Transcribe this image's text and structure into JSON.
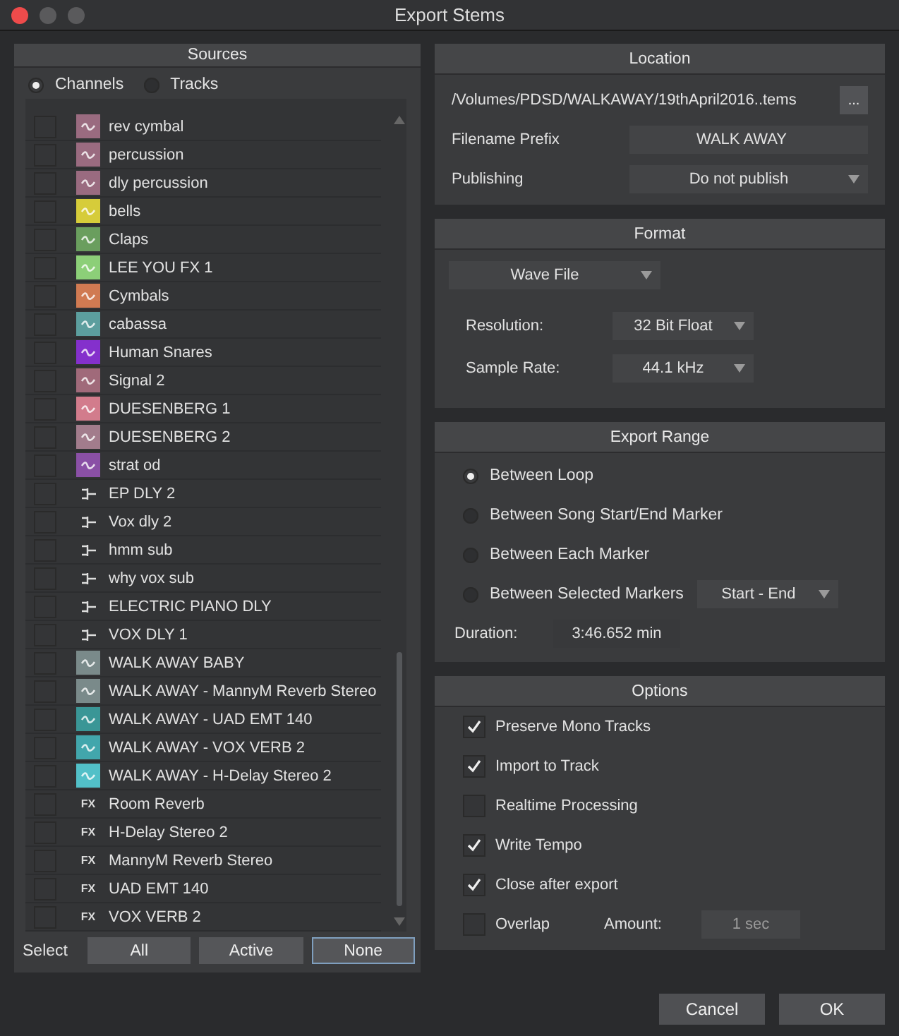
{
  "window": {
    "title": "Export Stems"
  },
  "sources": {
    "title": "Sources",
    "modes": [
      {
        "label": "Channels",
        "selected": true
      },
      {
        "label": "Tracks",
        "selected": false
      }
    ],
    "items": [
      {
        "kind": "audio",
        "name": "rev cymbal",
        "color": "#9a6b80",
        "checked": false
      },
      {
        "kind": "audio",
        "name": "percussion",
        "color": "#9a6b80",
        "checked": false
      },
      {
        "kind": "audio",
        "name": "dly percussion",
        "color": "#9a6b80",
        "checked": false
      },
      {
        "kind": "audio",
        "name": "bells",
        "color": "#d6cc3a",
        "checked": false
      },
      {
        "kind": "audio",
        "name": "Claps",
        "color": "#6a9e5e",
        "checked": false
      },
      {
        "kind": "audio",
        "name": "LEE YOU FX 1",
        "color": "#8ccf78",
        "checked": false
      },
      {
        "kind": "audio",
        "name": "Cymbals",
        "color": "#d07a52",
        "checked": false
      },
      {
        "kind": "audio",
        "name": "cabassa",
        "color": "#5c9e9e",
        "checked": false
      },
      {
        "kind": "audio",
        "name": "Human Snares",
        "color": "#8430cc",
        "checked": false
      },
      {
        "kind": "audio",
        "name": "Signal 2",
        "color": "#a06a7a",
        "checked": false
      },
      {
        "kind": "audio",
        "name": "DUESENBERG 1",
        "color": "#d27c8c",
        "checked": false
      },
      {
        "kind": "audio",
        "name": "DUESENBERG 2",
        "color": "#a27c8c",
        "checked": false
      },
      {
        "kind": "audio",
        "name": "strat od",
        "color": "#8a50a6",
        "checked": false
      },
      {
        "kind": "bus",
        "name": "EP DLY 2",
        "checked": false
      },
      {
        "kind": "bus",
        "name": "Vox dly 2",
        "checked": false
      },
      {
        "kind": "bus",
        "name": "hmm sub",
        "checked": false
      },
      {
        "kind": "bus",
        "name": "why vox sub",
        "checked": false
      },
      {
        "kind": "bus",
        "name": "ELECTRIC PIANO DLY",
        "checked": false
      },
      {
        "kind": "bus",
        "name": "VOX DLY 1",
        "checked": false
      },
      {
        "kind": "audio",
        "name": "WALK AWAY BABY",
        "color": "#7a8a8a",
        "checked": false
      },
      {
        "kind": "audio",
        "name": "WALK AWAY - MannyM Reverb Stereo",
        "color": "#7a8a8a",
        "checked": false
      },
      {
        "kind": "audio",
        "name": "WALK AWAY - UAD EMT 140",
        "color": "#3a9696",
        "checked": false
      },
      {
        "kind": "audio",
        "name": "WALK AWAY - VOX VERB 2",
        "color": "#42a6ac",
        "checked": false
      },
      {
        "kind": "audio",
        "name": "WALK AWAY - H-Delay Stereo 2",
        "color": "#52c0c8",
        "checked": false
      },
      {
        "kind": "fx",
        "badge": "FX",
        "name": "Room Reverb",
        "checked": false
      },
      {
        "kind": "fx",
        "badge": "FX",
        "name": "H-Delay Stereo 2",
        "checked": false
      },
      {
        "kind": "fx",
        "badge": "FX",
        "name": "MannyM Reverb Stereo",
        "checked": false
      },
      {
        "kind": "fx",
        "badge": "FX",
        "name": "UAD EMT 140",
        "checked": false
      },
      {
        "kind": "fx",
        "badge": "FX",
        "name": "VOX VERB 2",
        "checked": false
      }
    ],
    "select_label": "Select",
    "select_buttons": [
      {
        "label": "All",
        "selected": false
      },
      {
        "label": "Active",
        "selected": false
      },
      {
        "label": "None",
        "selected": true
      }
    ]
  },
  "location": {
    "title": "Location",
    "path": "/Volumes/PDSD/WALKAWAY/19thApril2016..tems",
    "browse": "...",
    "prefix_label": "Filename Prefix",
    "prefix": "WALK AWAY",
    "publishing_label": "Publishing",
    "publishing": "Do not publish"
  },
  "format": {
    "title": "Format",
    "file_type": "Wave File",
    "resolution_label": "Resolution:",
    "resolution": "32 Bit Float",
    "rate_label": "Sample Rate:",
    "rate": "44.1 kHz"
  },
  "export_range": {
    "title": "Export Range",
    "options": [
      {
        "label": "Between Loop",
        "selected": true
      },
      {
        "label": "Between Song Start/End Marker",
        "selected": false
      },
      {
        "label": "Between Each Marker",
        "selected": false
      },
      {
        "label": "Between Selected Markers",
        "selected": false
      }
    ],
    "markers": "Start - End",
    "duration_label": "Duration:",
    "duration": "3:46.652 min"
  },
  "options": {
    "title": "Options",
    "items": [
      {
        "label": "Preserve Mono Tracks",
        "checked": true
      },
      {
        "label": "Import to Track",
        "checked": true
      },
      {
        "label": "Realtime Processing",
        "checked": false
      },
      {
        "label": "Write Tempo",
        "checked": true
      },
      {
        "label": "Close after export",
        "checked": true
      },
      {
        "label": "Overlap",
        "checked": false
      }
    ],
    "amount_label": "Amount:",
    "amount": "1 sec"
  },
  "buttons": [
    "Cancel",
    "OK"
  ]
}
